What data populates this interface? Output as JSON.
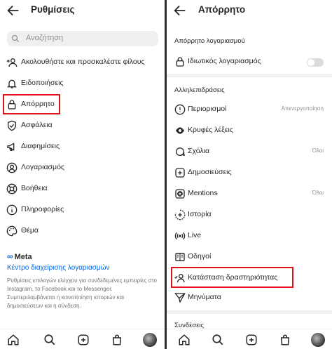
{
  "left": {
    "title": "Ρυθμίσεις",
    "search_placeholder": "Αναζήτηση",
    "items": [
      {
        "label": "Ακολουθήστε και προσκαλέστε φίλους",
        "icon": "add-person-icon"
      },
      {
        "label": "Ειδοποιήσεις",
        "icon": "bell-icon"
      },
      {
        "label": "Απόρρητο",
        "icon": "lock-icon"
      },
      {
        "label": "Ασφάλεια",
        "icon": "shield-icon"
      },
      {
        "label": "Διαφημίσεις",
        "icon": "megaphone-icon"
      },
      {
        "label": "Λογαριασμός",
        "icon": "account-icon"
      },
      {
        "label": "Βοήθεια",
        "icon": "lifebuoy-icon"
      },
      {
        "label": "Πληροφορίες",
        "icon": "info-icon"
      },
      {
        "label": "Θέμα",
        "icon": "palette-icon"
      }
    ],
    "meta_logo": "Meta",
    "account_center_link": "Κέντρο διαχείρισης λογαριασμών",
    "description": "Ρυθμίσεις επιλογών ελέγχου για συνδεδεμένες εμπειρίες στο Instagram, το Facebook και το Messenger. Συμπεριλαμβάνεται η κοινοποίηση ιστοριών και δημοσιεύσεων και η σύνδεση."
  },
  "right": {
    "title": "Απόρρητο",
    "section_account": "Απόρρητο λογαριασμού",
    "private_account_label": "Ιδιωτικός λογαριασμός",
    "private_account_on": false,
    "section_interactions": "Αλληλεπιδράσεις",
    "items": [
      {
        "label": "Περιορισμοί",
        "value": "Απενεργοποίηση",
        "icon": "restrict-icon"
      },
      {
        "label": "Κρυφές λέξεις",
        "value": "",
        "icon": "hidden-words-icon"
      },
      {
        "label": "Σχόλια",
        "value": "Όλοι",
        "icon": "comment-icon"
      },
      {
        "label": "Δημοσιεύσεις",
        "value": "",
        "icon": "plus-square-icon"
      },
      {
        "label": "Mentions",
        "value": "Όλοι",
        "icon": "at-icon"
      },
      {
        "label": "Ιστορία",
        "value": "",
        "icon": "story-icon"
      },
      {
        "label": "Live",
        "value": "",
        "icon": "live-icon"
      },
      {
        "label": "Οδηγοί",
        "value": "",
        "icon": "book-icon"
      },
      {
        "label": "Κατάσταση δραστηριότητας",
        "value": "",
        "icon": "activity-status-icon"
      },
      {
        "label": "Μηνύματα",
        "value": "",
        "icon": "send-icon"
      }
    ],
    "section_connections": "Συνδέσεις"
  },
  "nav": [
    "home-icon",
    "search-icon",
    "new-post-icon",
    "shop-icon",
    "profile-avatar"
  ],
  "colors": {
    "highlight": "#e0131b",
    "link": "#0064e0",
    "text": "#262626",
    "muted": "#8e8e8e"
  }
}
